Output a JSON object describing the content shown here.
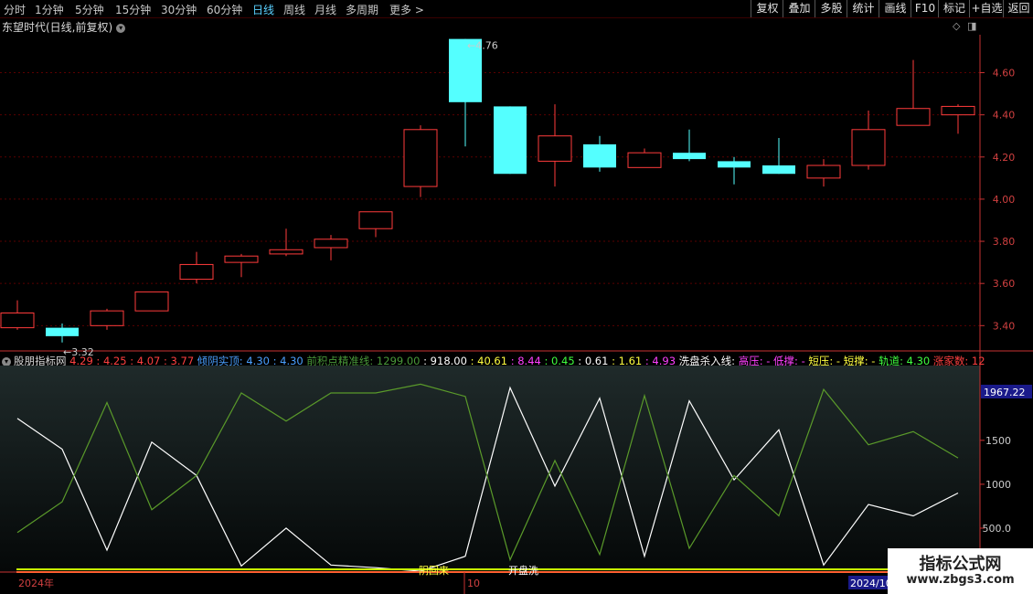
{
  "toolbar": {
    "periods": [
      {
        "label": "分时",
        "active": false
      },
      {
        "label": "1分钟",
        "active": false
      },
      {
        "label": "5分钟",
        "active": false
      },
      {
        "label": "15分钟",
        "active": false
      },
      {
        "label": "30分钟",
        "active": false
      },
      {
        "label": "60分钟",
        "active": false
      },
      {
        "label": "日线",
        "active": true
      },
      {
        "label": "周线",
        "active": false
      },
      {
        "label": "月线",
        "active": false
      },
      {
        "label": "多周期",
        "active": false
      },
      {
        "label": "更多 >",
        "active": false
      }
    ],
    "actions": [
      "复权",
      "叠加",
      "多股",
      "统计",
      "画线",
      "F10",
      "标记",
      "+自选",
      "返回"
    ]
  },
  "stock_title": "东望时代(日线,前复权)",
  "chart_data": [
    {
      "type": "candlestick",
      "ylim": [
        3.28,
        4.78
      ],
      "yticks": [
        "4.60",
        "4.40",
        "4.20",
        "4.00",
        "3.80",
        "3.60",
        "3.40"
      ],
      "ytick_values": [
        4.6,
        4.4,
        4.2,
        4.0,
        3.8,
        3.6,
        3.4
      ],
      "candles": [
        {
          "o": 3.39,
          "c": 3.46,
          "h": 3.52,
          "l": 3.38
        },
        {
          "o": 3.39,
          "c": 3.35,
          "h": 3.41,
          "l": 3.32
        },
        {
          "o": 3.4,
          "c": 3.47,
          "h": 3.48,
          "l": 3.38
        },
        {
          "o": 3.47,
          "c": 3.56,
          "h": 3.56,
          "l": 3.47
        },
        {
          "o": 3.62,
          "c": 3.69,
          "h": 3.75,
          "l": 3.6
        },
        {
          "o": 3.7,
          "c": 3.73,
          "h": 3.74,
          "l": 3.63
        },
        {
          "o": 3.74,
          "c": 3.76,
          "h": 3.86,
          "l": 3.73
        },
        {
          "o": 3.77,
          "c": 3.81,
          "h": 3.83,
          "l": 3.71
        },
        {
          "o": 3.86,
          "c": 3.94,
          "h": 3.94,
          "l": 3.82
        },
        {
          "o": 4.06,
          "c": 4.33,
          "h": 4.35,
          "l": 4.01
        },
        {
          "o": 4.76,
          "c": 4.46,
          "h": 4.76,
          "l": 4.25
        },
        {
          "o": 4.44,
          "c": 4.12,
          "h": 4.44,
          "l": 4.12
        },
        {
          "o": 4.18,
          "c": 4.3,
          "h": 4.45,
          "l": 4.06
        },
        {
          "o": 4.26,
          "c": 4.15,
          "h": 4.3,
          "l": 4.13
        },
        {
          "o": 4.15,
          "c": 4.22,
          "h": 4.24,
          "l": 4.15
        },
        {
          "o": 4.22,
          "c": 4.19,
          "h": 4.33,
          "l": 4.18
        },
        {
          "o": 4.18,
          "c": 4.15,
          "h": 4.2,
          "l": 4.07
        },
        {
          "o": 4.16,
          "c": 4.12,
          "h": 4.29,
          "l": 4.12
        },
        {
          "o": 4.1,
          "c": 4.16,
          "h": 4.19,
          "l": 4.06
        },
        {
          "o": 4.16,
          "c": 4.33,
          "h": 4.42,
          "l": 4.14
        },
        {
          "o": 4.35,
          "c": 4.43,
          "h": 4.66,
          "l": 4.35
        },
        {
          "o": 4.4,
          "c": 4.44,
          "h": 4.45,
          "l": 4.31
        }
      ],
      "annotations": {
        "high_label": "4.76",
        "low_label": "3.32"
      },
      "colors": {
        "up": "#ff3b3b",
        "down": "#54ffff",
        "grid": "#5a0000",
        "axis": "#c83232"
      }
    },
    {
      "type": "line",
      "ylim": [
        0,
        2300
      ],
      "yticks": [
        "1500",
        "1000",
        "500.0"
      ],
      "ytick_values": [
        1500,
        1000,
        500
      ],
      "current_value": "1967.22",
      "series": [
        {
          "color": "#ffffff",
          "values": [
            1750,
            1400,
            250,
            1480,
            1100,
            70,
            500,
            80,
            50,
            10,
            180,
            2100,
            980,
            1980,
            180,
            1950,
            1050,
            1620,
            80,
            770,
            640,
            900
          ]
        },
        {
          "color": "#5a9a2a",
          "values": [
            450,
            800,
            1930,
            710,
            1100,
            2040,
            1720,
            2040,
            2040,
            2140,
            2000,
            140,
            1270,
            200,
            2010,
            270,
            1100,
            640,
            2080,
            1450,
            1600,
            1300
          ]
        }
      ],
      "signals": {
        "mid": "阴回来",
        "right": "开盘洗"
      },
      "date_labels": {
        "start": "2024年",
        "mid": "10",
        "end": "2024/10"
      }
    }
  ],
  "indicator_panel": {
    "name": "股朋指标网",
    "segments": [
      {
        "text": "4.29",
        "color": "#ff4040"
      },
      {
        "text": "4.25",
        "color": "#ff4040"
      },
      {
        "text": "4.07",
        "color": "#ff4040"
      },
      {
        "text": "3.77",
        "color": "#ff4040"
      },
      {
        "text": "倾阴实顶: 4.30",
        "color": "#4aa0ff"
      },
      {
        "text": "4.30",
        "color": "#4aa0ff"
      },
      {
        "text": "前积点精准线: 1299.00",
        "color": "#4a9a3a"
      },
      {
        "text": "918.00",
        "color": "#ffffff"
      },
      {
        "text": "40.61",
        "color": "#ffff40"
      },
      {
        "text": "8.44",
        "color": "#ff40ff"
      },
      {
        "text": "0.45",
        "color": "#40ff40"
      },
      {
        "text": "0.61",
        "color": "#ffffff"
      },
      {
        "text": "1.61",
        "color": "#ffff40"
      },
      {
        "text": "4.93",
        "color": "#ff40ff"
      },
      {
        "text": "洗盘杀入线:",
        "color": "#ffffff"
      },
      {
        "text": "高压: -",
        "color": "#ff40ff"
      },
      {
        "text": "低撑: -",
        "color": "#ff40ff"
      },
      {
        "text": "短压: -",
        "color": "#ffff40"
      },
      {
        "text": "短撑: -",
        "color": "#ffff40"
      },
      {
        "text": "轨道: 4.30",
        "color": "#40ff40"
      },
      {
        "text": "涨家数: 12",
        "color": "#ff4040"
      }
    ]
  },
  "watermark": {
    "title": "指标公式网",
    "url": "www.zbgs3.com"
  }
}
